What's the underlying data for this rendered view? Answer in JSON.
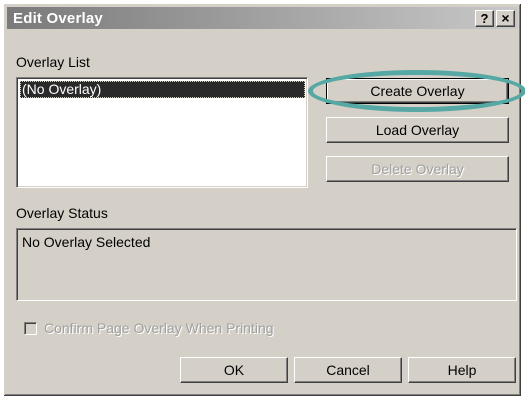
{
  "window": {
    "title": "Edit Overlay",
    "help_label": "?",
    "close_label": "×"
  },
  "overlay_list": {
    "label": "Overlay List",
    "items": [
      {
        "label": "(No Overlay)",
        "selected": true
      }
    ]
  },
  "actions": {
    "create_label": "Create Overlay",
    "load_label": "Load Overlay",
    "delete_label": "Delete Overlay",
    "delete_enabled": false
  },
  "overlay_status": {
    "label": "Overlay Status",
    "text": "No Overlay Selected"
  },
  "confirm": {
    "label": "Confirm Page Overlay When Printing",
    "checked": false,
    "enabled": false
  },
  "footer": {
    "ok_label": "OK",
    "cancel_label": "Cancel",
    "help_label": "Help"
  },
  "colors": {
    "highlight_ring": "#55a8a4",
    "dialog_face": "#d4d0c8"
  }
}
